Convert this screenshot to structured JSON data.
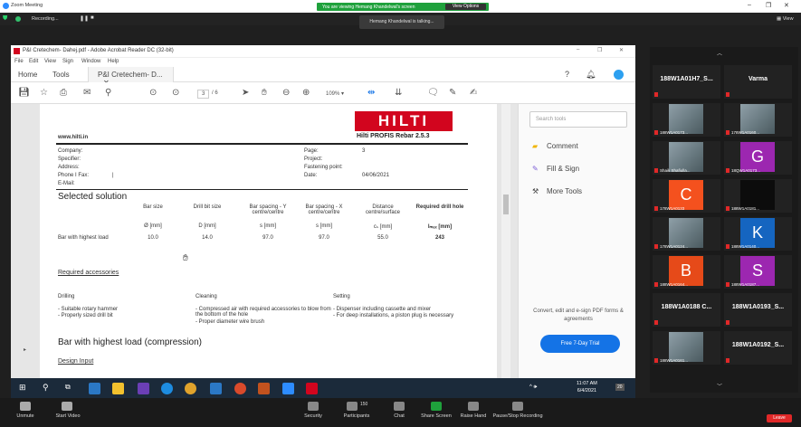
{
  "zoom": {
    "window_title": "Zoom Meeting",
    "viewing_banner": "You are viewing Hemang Khandelwal's screen",
    "view_options": "View Options",
    "recording": "Recording...",
    "talking": "Hemang Khandelwal is talking...",
    "view_label": "View",
    "bottom_bar": [
      {
        "label": "Unmute",
        "icon": "mic-muted-icon"
      },
      {
        "label": "Start Video",
        "icon": "video-off-icon"
      },
      {
        "label": "Security",
        "icon": "shield-icon"
      },
      {
        "label": "Participants",
        "icon": "participants-icon",
        "count": "150"
      },
      {
        "label": "Chat",
        "icon": "chat-icon"
      },
      {
        "label": "Share Screen",
        "icon": "share-screen-icon"
      },
      {
        "label": "Raise Hand",
        "icon": "raise-hand-icon"
      },
      {
        "label": "Pause/Stop Recording",
        "icon": "pause-recording-icon"
      }
    ],
    "leave": "Leave"
  },
  "acrobat": {
    "title": "P&I Cretechem- Dahej.pdf - Adobe Acrobat Reader DC (32-bit)",
    "menu": [
      "File",
      "Edit",
      "View",
      "Sign",
      "Window",
      "Help"
    ],
    "tabs": [
      "Home",
      "Tools"
    ],
    "doc_tab": "P&I Cretechem- D...",
    "page_current": "3",
    "page_total": "/ 6",
    "zoom": "109%",
    "search_tools": "Search tools",
    "tools": [
      "Comment",
      "Fill & Sign",
      "More Tools"
    ],
    "promo": "Convert, edit and e-sign PDF forms & agreements",
    "trial": "Free 7-Day Trial"
  },
  "doc": {
    "website": "www.hilti.in",
    "logo": "HILTI",
    "product": "Hilti PROFIS Rebar 2.5.3",
    "fields_left": [
      "Company:",
      "Specifier:",
      "Address:",
      "Phone I Fax:",
      "E-Mail:"
    ],
    "phone_sep": "|",
    "fields_right": [
      "Page:",
      "Project:",
      "Fastening point:",
      "Date:"
    ],
    "page_value": "3",
    "date_value": "04/06/2021",
    "section_selected": "Selected solution",
    "headers": [
      "Bar size",
      "Drill bit size",
      "Bar spacing - Y centre/centre",
      "Bar spacing - X centre/centre",
      "Distance centre/surface",
      "Required drill hole"
    ],
    "units": [
      "Ø [mm]",
      "D [mm]",
      "s [mm]",
      "s [mm]",
      "cₛ [mm]",
      "lₘₐₓ [mm]"
    ],
    "row_label": "Bar with highest load",
    "row_values": [
      "10.0",
      "14.0",
      "97.0",
      "97.0",
      "55.0",
      "243"
    ],
    "required_accessories": "Required accessories",
    "acc_heads": [
      "Drilling",
      "Cleaning",
      "Setting"
    ],
    "drilling": [
      "- Suitable rotary hammer",
      "- Properly sized drill bit"
    ],
    "cleaning": [
      "- Compressed air with required accessories to blow from the bottom of the hole",
      "- Proper diameter wire brush"
    ],
    "setting": [
      "- Dispenser including cassette and mixer",
      "- For deep installations, a piston plug is necessary"
    ],
    "section_compression": "Bar with highest load (compression)",
    "design_input": "Design Input"
  },
  "taskbar": {
    "time": "11:07 AM",
    "date": "6/4/2021",
    "notif": "20"
  },
  "gallery": [
    {
      "name": "188W1A01H7_S...",
      "type": "name"
    },
    {
      "name": "Varma",
      "type": "name"
    },
    {
      "name": "188W1A0173...",
      "type": "photo"
    },
    {
      "name": "178W1A0160...",
      "type": "photo"
    },
    {
      "name": "Shaik Shafiulla...",
      "type": "photo"
    },
    {
      "name": "18QW1A0173...",
      "type": "letter",
      "letter": "G",
      "color": "#9c27b0"
    },
    {
      "name": "178W1A0133",
      "type": "letter",
      "letter": "C",
      "color": "#f4511e"
    },
    {
      "name": "188W1A0181...",
      "type": "dark"
    },
    {
      "name": "178W1A0124...",
      "type": "photo"
    },
    {
      "name": "188W1A0140...",
      "type": "letter",
      "letter": "K",
      "color": "#1565c0"
    },
    {
      "name": "188W1A0164...",
      "type": "letter",
      "letter": "B",
      "color": "#e64a19"
    },
    {
      "name": "188W1A0187...",
      "type": "letter",
      "letter": "S",
      "color": "#9c27b0"
    },
    {
      "name": "188W1A0188 C...",
      "type": "name"
    },
    {
      "name": "188W1A0193_S...",
      "type": "name"
    },
    {
      "name": "188W1A0161...",
      "type": "photo"
    },
    {
      "name": "188W1A0192_S...",
      "type": "name"
    }
  ]
}
